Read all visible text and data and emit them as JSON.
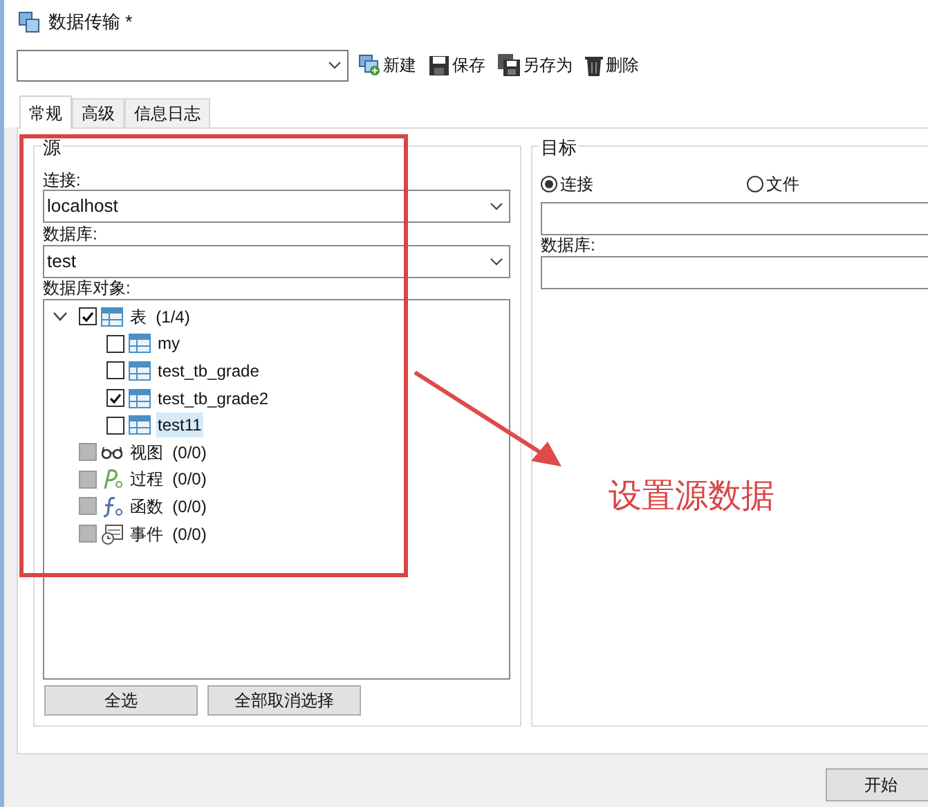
{
  "window": {
    "title": "数据传输 *"
  },
  "toolbar": {
    "buttons": [
      {
        "kind": "new",
        "label": "新建"
      },
      {
        "kind": "save",
        "label": "保存"
      },
      {
        "kind": "saveas",
        "label": "另存为"
      },
      {
        "kind": "delete",
        "label": "删除"
      }
    ]
  },
  "tabs": [
    {
      "label": "常规",
      "selected": true
    },
    {
      "label": "高级",
      "selected": false
    },
    {
      "label": "信息日志",
      "selected": false
    }
  ],
  "source": {
    "title": "源",
    "connection_label": "连接:",
    "connection": "localhost",
    "database_label": "数据库:",
    "database": "test",
    "objects_label": "数据库对象:",
    "tree": [
      {
        "kind": "table",
        "label": "表",
        "count": "(1/4)",
        "checked": true,
        "disabled": false,
        "expanded": true,
        "children": [
          {
            "label": "my",
            "checked": false,
            "selected": false
          },
          {
            "label": "test_tb_grade",
            "checked": false,
            "selected": false
          },
          {
            "label": "test_tb_grade2",
            "checked": true,
            "selected": false
          },
          {
            "label": "test11",
            "checked": false,
            "selected": true
          }
        ]
      },
      {
        "kind": "view",
        "label": "视图",
        "count": "(0/0)",
        "checked": false,
        "disabled": true
      },
      {
        "kind": "procedure",
        "label": "过程",
        "count": "(0/0)",
        "checked": false,
        "disabled": true
      },
      {
        "kind": "function",
        "label": "函数",
        "count": "(0/0)",
        "checked": false,
        "disabled": true
      },
      {
        "kind": "event",
        "label": "事件",
        "count": "(0/0)",
        "checked": false,
        "disabled": true
      }
    ],
    "buttons": [
      "全选",
      "全部取消选择"
    ]
  },
  "target": {
    "title": "目标",
    "options": [
      {
        "label": "连接",
        "selected": true
      },
      {
        "label": "文件",
        "selected": false
      }
    ],
    "database_label": "数据库:"
  },
  "footer": {
    "start_button": "开始"
  },
  "annotation": {
    "text": "设置源数据"
  }
}
